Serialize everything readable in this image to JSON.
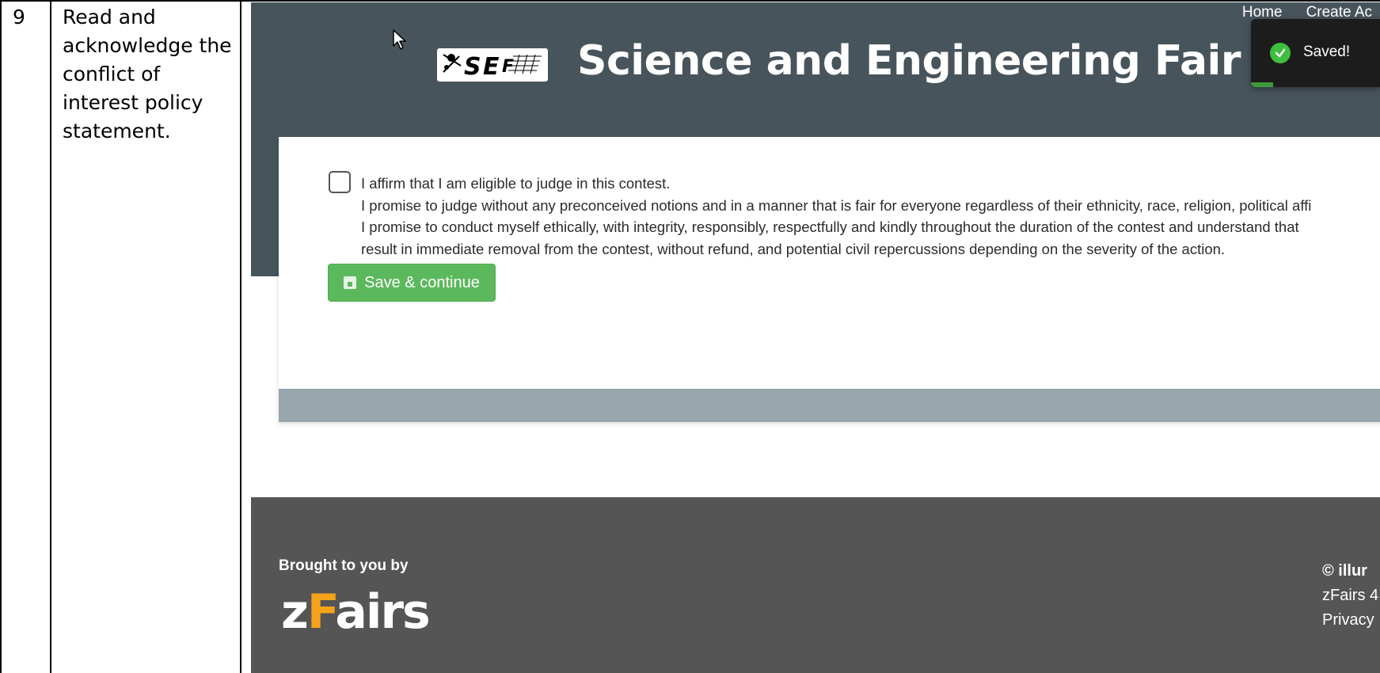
{
  "step": {
    "number": "9",
    "description": "Read and acknowledge the conflict of interest policy statement."
  },
  "nav": {
    "home": "Home",
    "create_account": "Create Ac"
  },
  "site": {
    "title": "Science and Engineering Fair of Metro",
    "logo_text": "SEF"
  },
  "affirmation": {
    "line1": "I affirm that I am eligible to judge in this contest.",
    "line2": "I promise to judge without any preconceived notions and in a manner that is fair for everyone regardless of their ethnicity, race, religion, political affi",
    "line3": "I promise to conduct myself ethically, with integrity, responsibly, respectfully and kindly throughout the duration of the contest and understand that",
    "line4": "result in immediate removal from the contest, without refund, and potential civil repercussions depending on the severity of the action."
  },
  "buttons": {
    "save_continue": "Save & continue"
  },
  "footer": {
    "brought_by": "Brought to you by",
    "brand_z": "z",
    "brand_f": "F",
    "brand_rest": "airs",
    "copyright": "© illur",
    "version": "zFairs 4",
    "privacy": "Privacy"
  },
  "toast": {
    "message": "Saved!"
  },
  "colors": {
    "header_bg": "#48545c",
    "footer_bg": "#555555",
    "button_green": "#5cb85c",
    "brand_orange": "#f5a31a",
    "toast_bg": "#1c1c1c"
  }
}
